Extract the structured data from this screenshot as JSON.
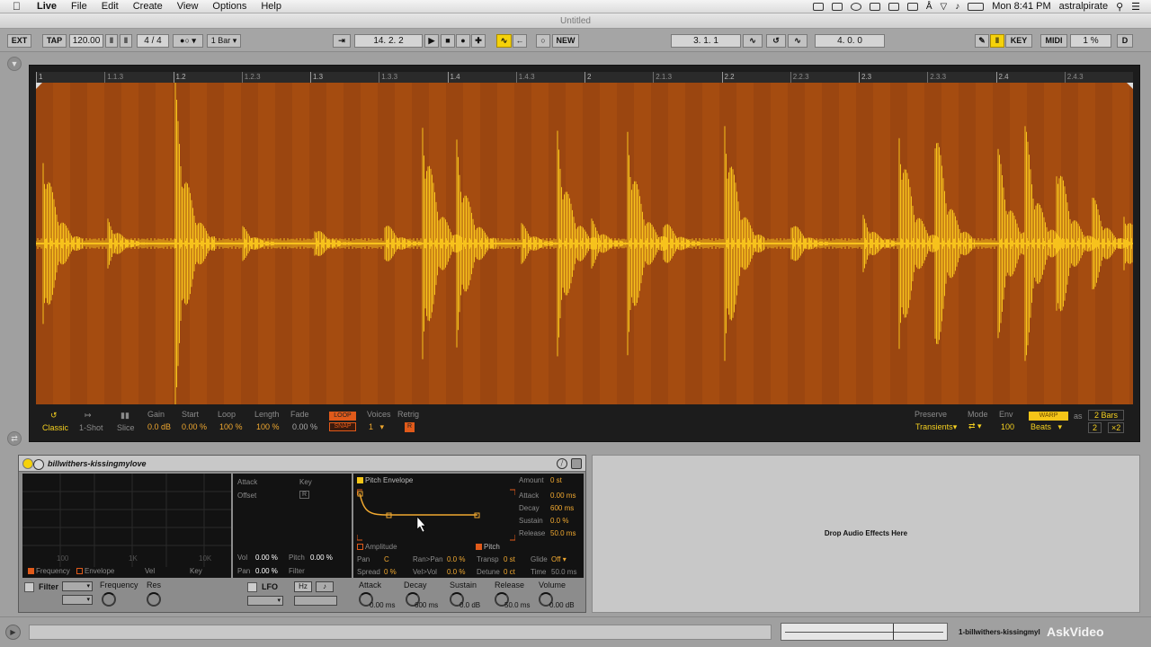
{
  "menubar": {
    "app": "Live",
    "items": [
      "File",
      "Edit",
      "Create",
      "View",
      "Options",
      "Help"
    ],
    "clock": "Mon 8:41 PM",
    "user": "astralpirate"
  },
  "window": {
    "title": "Untitled"
  },
  "transport": {
    "ext": "EXT",
    "tap": "TAP",
    "tempo": "120.00",
    "signature": "4 / 4",
    "quantization": "1 Bar",
    "position": "14.  2.  2",
    "new": "NEW",
    "loop_start": "3.  1.  1",
    "loop_length": "4.  0.  0",
    "key": "KEY",
    "midi": "MIDI",
    "cpu": "1 %",
    "disk": "D"
  },
  "ruler": {
    "labels": [
      "1",
      "1.1.3",
      "1.2",
      "1.2.3",
      "1.3",
      "1.3.3",
      "1.4",
      "1.4.3",
      "2",
      "2.1.3",
      "2.2",
      "2.2.3",
      "2.3",
      "2.3.3",
      "2.4",
      "2.4.3"
    ]
  },
  "clip_controls": {
    "classic": "Classic",
    "one_shot": "1-Shot",
    "slice": "Slice",
    "gain_label": "Gain",
    "gain": "0.0 dB",
    "start_label": "Start",
    "start": "0.00 %",
    "loop_label": "Loop",
    "loop": "100 %",
    "length_label": "Length",
    "length": "100 %",
    "fade_label": "Fade",
    "fade": "0.00 %",
    "loop_btn": "LOOP",
    "snap_btn": "SNAP",
    "voices_label": "Voices",
    "voices": "1",
    "retrig_label": "Retrig",
    "retrig": "R",
    "preserve_label": "Preserve",
    "preserve": "Transients",
    "mode_label": "Mode",
    "env_label": "Env",
    "env": "100",
    "warp": "WARP",
    "warp_mode": "Beats",
    "as_label": "as",
    "bars": "2 Bars",
    "halve": "2",
    "double": "×2"
  },
  "device": {
    "title": "billwithers-kissingmylove",
    "filter_tabs": {
      "frequency": "Frequency",
      "envelope": "Envelope",
      "vel": "Vel",
      "key": "Key"
    },
    "freq_ticks": {
      "t100": "100",
      "t1k": "1K",
      "t10k": "10K"
    },
    "mod": {
      "attack": "Attack",
      "key": "Key",
      "offset": "Offset",
      "offset_btn": "R",
      "vol_label": "Vol",
      "vol": "0.00 %",
      "pitch_label": "Pitch",
      "pitch": "0.00 %",
      "pan_label": "Pan",
      "pan": "0.00 %",
      "filter_label": "Filter"
    },
    "envelope": {
      "title": "Pitch Envelope",
      "amount_label": "Amount",
      "amount": "0 st",
      "attack_label": "Attack",
      "attack": "0.00 ms",
      "decay_label": "Decay",
      "decay": "600 ms",
      "sustain_label": "Sustain",
      "sustain": "0.0 %",
      "release_label": "Release",
      "release": "50.0 ms",
      "amplitude_tab": "Amplitude",
      "pitch_tab": "Pitch"
    },
    "voice": {
      "pan_label": "Pan",
      "pan": "C",
      "ranpan_label": "Ran>Pan",
      "ranpan": "0.0 %",
      "transp_label": "Transp",
      "transp": "0 st",
      "glide_label": "Glide",
      "glide": "Off",
      "spread_label": "Spread",
      "spread": "0 %",
      "velvol_label": "Vel>Vol",
      "velvol": "0.0 %",
      "detune_label": "Detune",
      "detune": "0 ct",
      "time_label": "Time",
      "time": "50.0 ms"
    },
    "filter_row": {
      "filter": "Filter",
      "frequency": "Frequency",
      "res": "Res",
      "lfo": "LFO",
      "hz": "Hz",
      "note": "♪"
    },
    "knobs": [
      {
        "label": "Attack",
        "value": "0.00 ms"
      },
      {
        "label": "Decay",
        "value": "600 ms"
      },
      {
        "label": "Sustain",
        "value": "0.0 dB"
      },
      {
        "label": "Release",
        "value": "50.0 ms"
      },
      {
        "label": "Volume",
        "value": "0.00 dB"
      }
    ]
  },
  "dropzone": {
    "text": "Drop Audio Effects Here"
  },
  "bottom": {
    "track": "1-billwithers-kissingmyl",
    "watermark": "AskVideo"
  },
  "colors": {
    "waveform": "#f7c21c",
    "waveform_bg": "#a54c10",
    "accent": "#f0a830",
    "orange": "#e05a1a"
  }
}
